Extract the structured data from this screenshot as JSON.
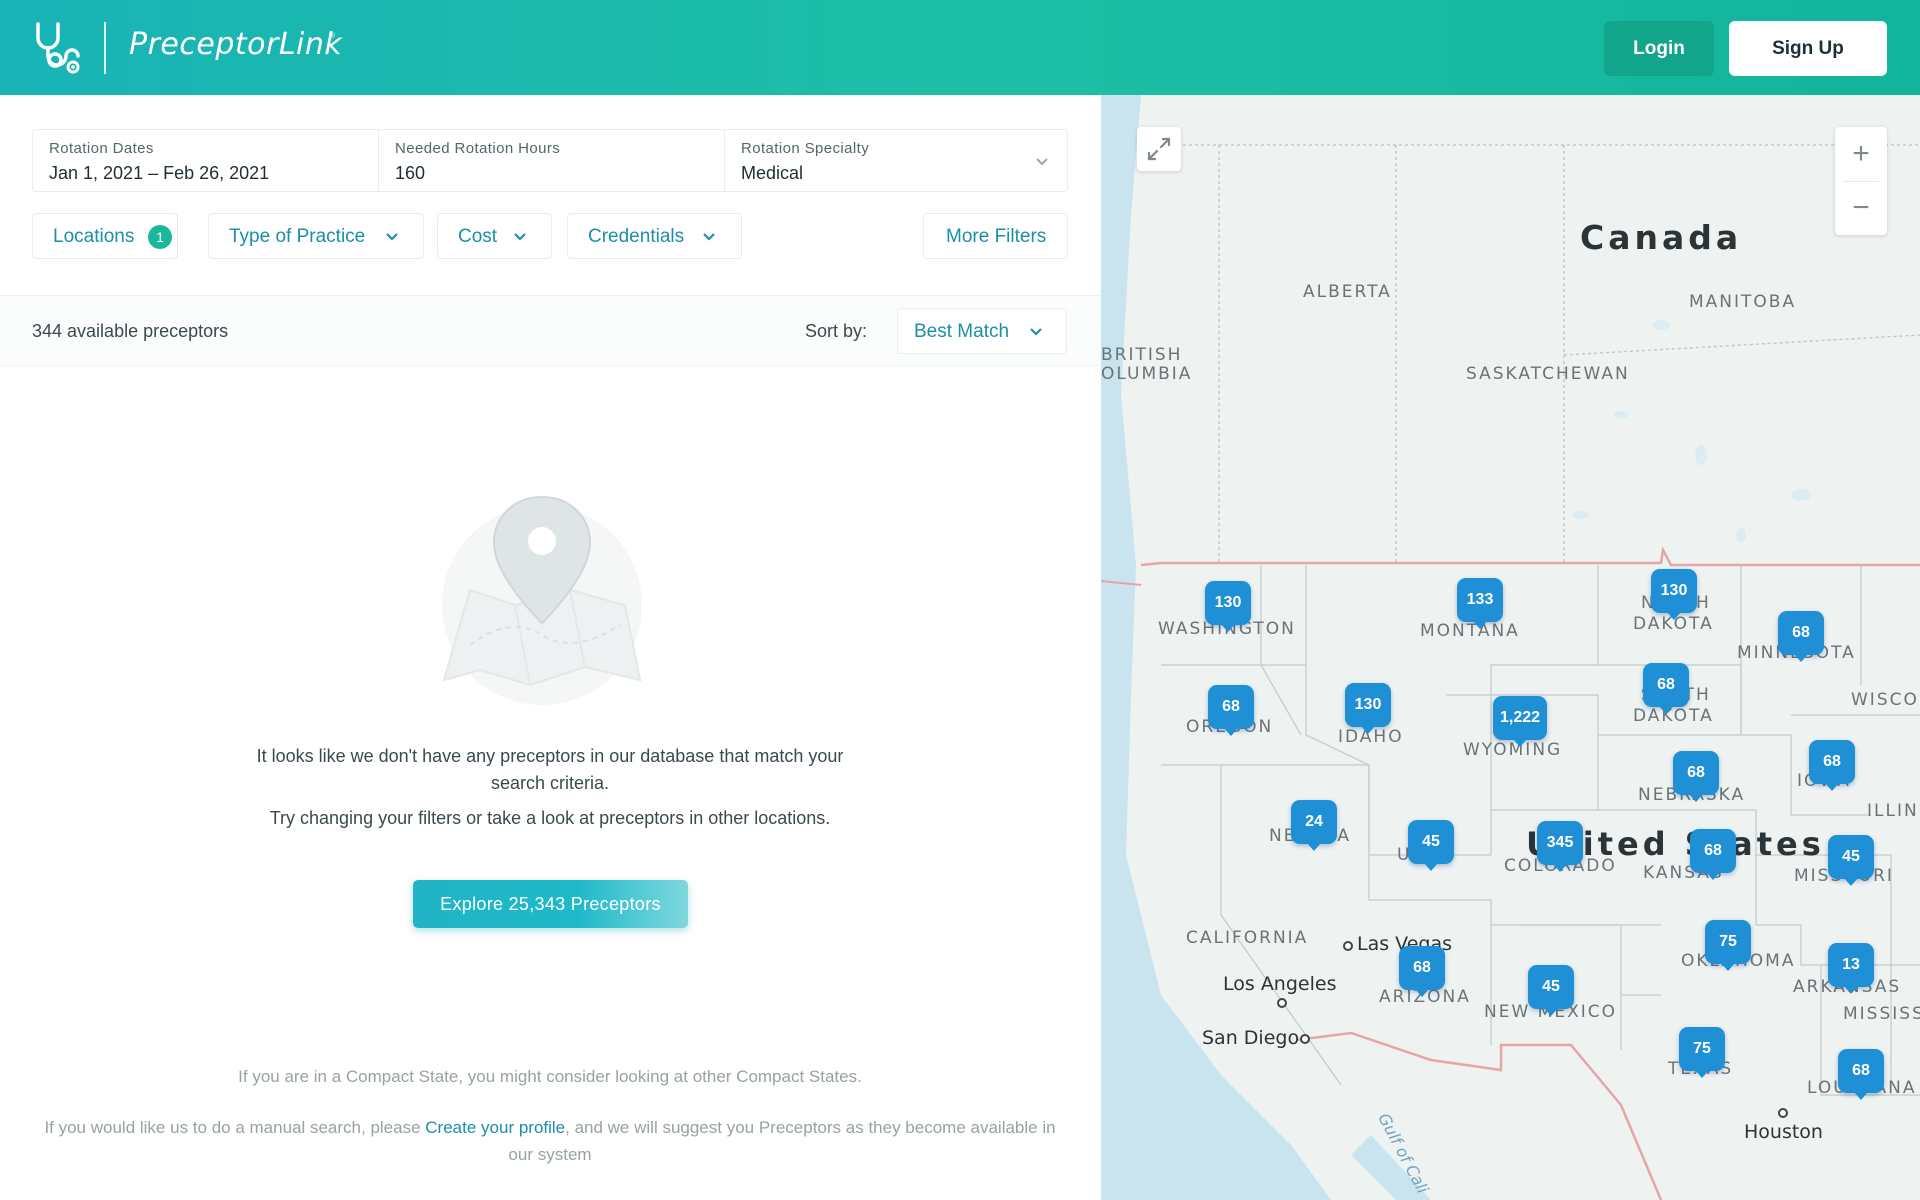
{
  "header": {
    "brand": "PreceptorLink",
    "brand_mark": "®",
    "login_label": "Login",
    "signup_label": "Sign Up"
  },
  "filters": {
    "rotation_dates": {
      "label": "Rotation Dates",
      "value": "Jan 1, 2021 – Feb 26, 2021"
    },
    "rotation_hours": {
      "label": "Needed Rotation Hours",
      "value": "160"
    },
    "rotation_specialty": {
      "label": "Rotation Specialty",
      "value": "Medical"
    },
    "chips": {
      "locations": {
        "label": "Locations",
        "badge": "1"
      },
      "type_of_practice": {
        "label": "Type of Practice"
      },
      "cost": {
        "label": "Cost"
      },
      "credentials": {
        "label": "Credentials"
      },
      "more_filters": {
        "label": "More Filters"
      }
    }
  },
  "results": {
    "count_text": "344 available preceptors",
    "sort_label": "Sort by:",
    "sort_value": "Best Match"
  },
  "empty_state": {
    "message_line1": "It looks like we don't have any preceptors in our database that match your search criteria.",
    "message_line2": "Try changing your filters or take a look at preceptors in other locations.",
    "explore_button": "Explore 25,343 Preceptors"
  },
  "footer": {
    "compact_note": "If you are in a Compact State, you might consider looking at other Compact States.",
    "manual_prefix": "If you would like us to do a manual search, please ",
    "manual_link": "Create your profile",
    "manual_suffix": ", and we will suggest you Preceptors as they become available in our system"
  },
  "map": {
    "labels": {
      "canada": "Canada",
      "united_states": "United States",
      "alberta": "ALBERTA",
      "manitoba": "MANITOBA",
      "british": "BRITISH",
      "columbia": "OLUMBIA",
      "saskatchewan": "SASKATCHEWAN",
      "washington": "WASHINGTON",
      "montana": "MONTANA",
      "north": "NORTH",
      "dakota1": "DAKOTA",
      "minnesota": "MINNESOTA",
      "wisco": "WISCO",
      "oregon": "OREGON",
      "idaho": "IDAHO",
      "wyoming": "WYOMING",
      "south": "SOUTH",
      "dakota2": "DAKOTA",
      "iowa": "IOWA",
      "nebraska": "NEBRASKA",
      "illin": "ILLIN",
      "nevada": "NEVADA",
      "utah": "UTAH",
      "colorado": "COLORADO",
      "kansas": "KANSAS",
      "missouri": "MISSOURI",
      "california": "CALIFORNIA",
      "oklahoma": "OKLAHOMA",
      "arkansas": "ARKANSAS",
      "mississ": "MISSISS",
      "arizona": "ARIZONA",
      "new_mexico": "NEW MEXICO",
      "texas": "TEXAS",
      "louisiana": "LOUISIANA",
      "las_vegas": "Las Vegas",
      "los_angeles": "Los Angeles",
      "san_diego": "San Diego",
      "houston": "Houston",
      "gulf": "Gulf of Cali"
    },
    "pins": {
      "washington": "130",
      "montana": "133",
      "north_dakota": "130",
      "minnesota": "68",
      "oregon": "68",
      "idaho": "130",
      "south_dakota": "68",
      "wyoming": "1,222",
      "iowa": "68",
      "nebraska": "68",
      "nevada": "24",
      "utah": "45",
      "colorado": "345",
      "kansas": "68",
      "missouri": "45",
      "oklahoma": "75",
      "arkansas": "13",
      "arizona": "68",
      "new_mexico": "45",
      "texas": "75",
      "louisiana": "68"
    },
    "zoom_in": "+",
    "zoom_out": "−",
    "colors": {
      "pin": "#1f8fd6",
      "border": "#e4a6a6"
    }
  }
}
